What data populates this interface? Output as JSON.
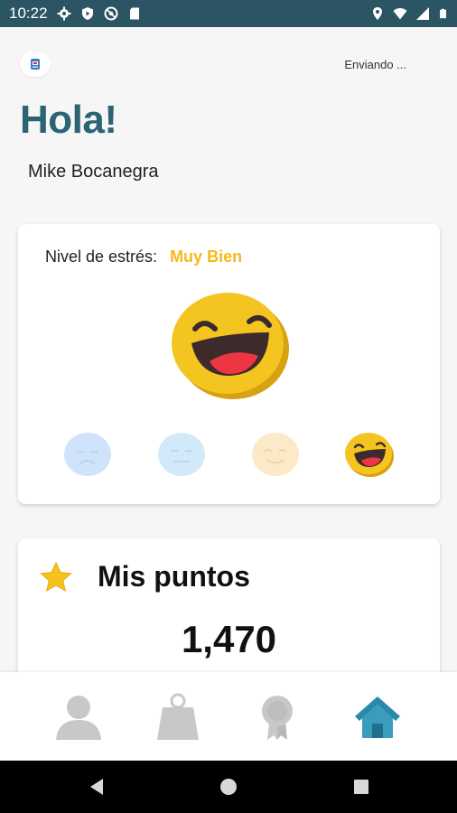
{
  "status_bar": {
    "time": "10:22",
    "left_icons": [
      "gear-icon",
      "play-shield-icon",
      "at-sign-icon",
      "sd-card-icon"
    ],
    "right_icons": [
      "location-icon",
      "wifi-icon",
      "signal-icon",
      "battery-icon"
    ]
  },
  "header": {
    "logo_icon": "app-logo-icon",
    "sending_status": "Enviando ...",
    "greeting": "Hola!",
    "user_name": "Mike Bocanegra"
  },
  "stress_card": {
    "label": "Nivel de estrés:",
    "level": "Muy Bien",
    "level_color": "#f5b91c",
    "current_mood_icon": "laughing-face-icon",
    "mood_options": [
      {
        "icon": "sad-face-icon",
        "color": "#cfe3fb",
        "selected": false
      },
      {
        "icon": "neutral-face-icon",
        "color": "#d2e9fa",
        "selected": false
      },
      {
        "icon": "smiling-face-icon",
        "color": "#fbe9c8",
        "selected": false
      },
      {
        "icon": "laughing-face-icon",
        "color": "#f4c520",
        "selected": true
      }
    ]
  },
  "points_card": {
    "icon": "star-icon",
    "title": "Mis puntos",
    "value": "1,470"
  },
  "bottom_nav": {
    "items": [
      {
        "icon": "profile-icon",
        "active": false
      },
      {
        "icon": "shopping-bag-icon",
        "active": false
      },
      {
        "icon": "medal-icon",
        "active": false
      },
      {
        "icon": "home-icon",
        "active": true
      }
    ],
    "active_color": "#2a88a8",
    "inactive_color": "#c8c8c8"
  },
  "system_nav": {
    "buttons": [
      "back-icon",
      "home-circle-icon",
      "recents-icon"
    ]
  },
  "colors": {
    "status_bar": "#2c5563",
    "greeting": "#2c6474",
    "background": "#f6f6f6"
  }
}
